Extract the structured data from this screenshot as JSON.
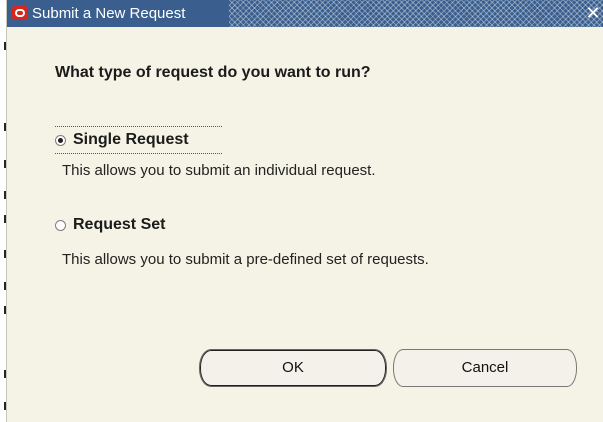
{
  "window": {
    "title": "Submit a New Request",
    "close_glyph": "✕"
  },
  "dialog": {
    "question": "What type of request do you want to run?",
    "options": [
      {
        "label": "Single Request",
        "description": "This allows you to submit an individual request.",
        "selected": true
      },
      {
        "label": "Request Set",
        "description": "This allows you to submit a pre-defined set of requests.",
        "selected": false
      }
    ],
    "buttons": {
      "ok_label": "OK",
      "cancel_label": "Cancel"
    }
  },
  "icons": {
    "app_logo": "oracle-logo-icon",
    "close": "close-icon",
    "radio": "radio-icon"
  },
  "colors": {
    "titlebar": "#3a5f8e",
    "logo": "#d8261d",
    "dialog_bg": "#f4f3e6"
  }
}
